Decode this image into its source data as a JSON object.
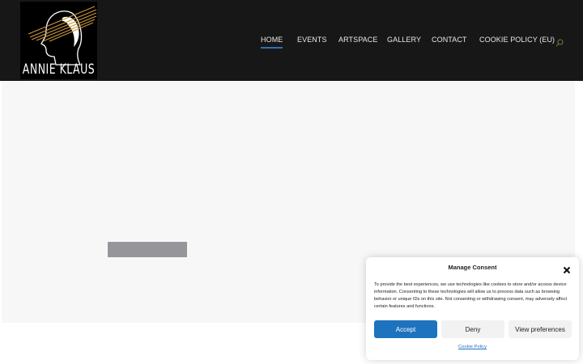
{
  "header": {
    "logo_text": "ANNIE KLAUS",
    "nav": [
      {
        "label": "HOME",
        "active": true
      },
      {
        "label": "EVENTS",
        "active": false
      },
      {
        "label": "ARTSPACE",
        "active": false
      },
      {
        "label": "GALLERY",
        "active": false
      },
      {
        "label": "CONTACT",
        "active": false
      },
      {
        "label": "COOKIE POLICY (EU)",
        "active": false
      }
    ],
    "search_icon": "search-icon"
  },
  "consent": {
    "title": "Manage Consent",
    "close_icon": "close-icon",
    "body": "To provide the best experiences, we use technologies like cookies to store and/or access device information. Consenting to these technologies will allow us to process data such as browsing behavior or unique IDs on this site. Not consenting or withdrawing consent, may adversely affect certain features and functions.",
    "accept_label": "Accept",
    "deny_label": "Deny",
    "preferences_label": "View preferences",
    "policy_link": "Cookie Policy"
  },
  "colors": {
    "header_bg": "#171717",
    "accent": "#1e73be",
    "active_underline": "#2f6fbd",
    "content_bg": "#f7f7f7",
    "logo_lines": "#c9973a"
  }
}
